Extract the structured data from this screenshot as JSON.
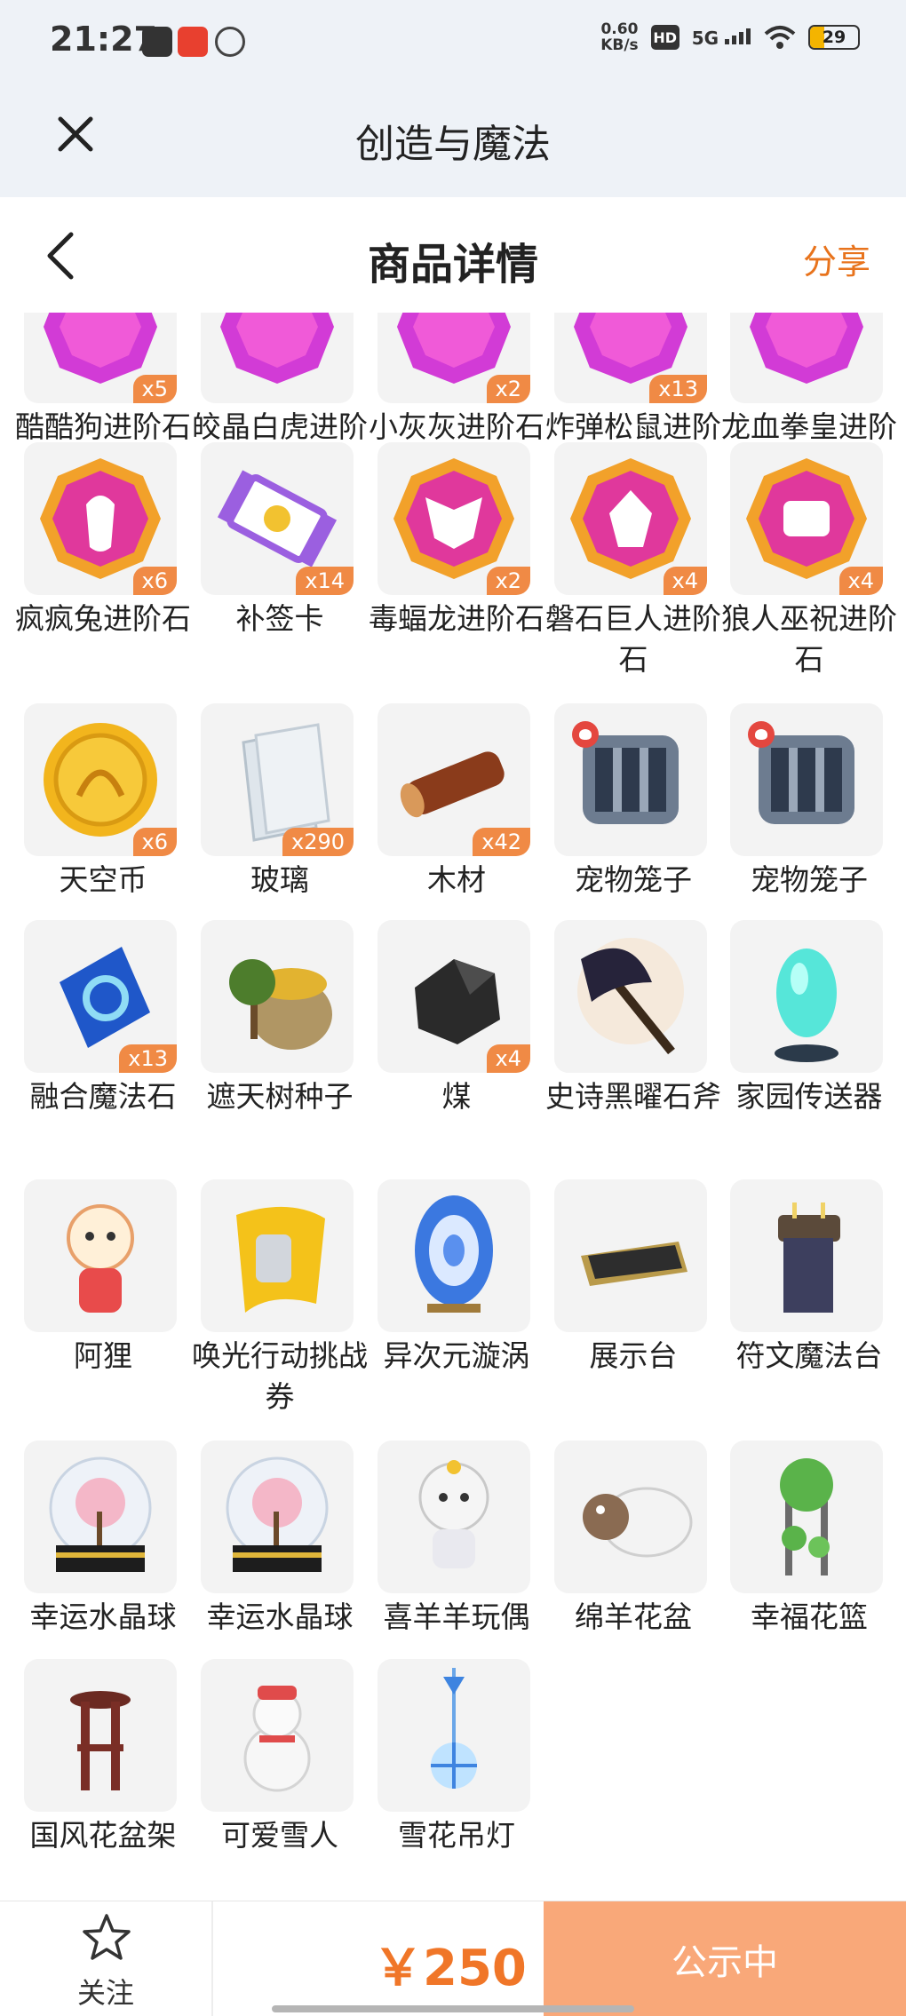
{
  "status_bar": {
    "time": "21:27",
    "net_speed": "0.60",
    "net_unit": "KB/s",
    "hd": "HD",
    "signal": "5G",
    "battery": "29"
  },
  "header": {
    "title": "创造与魔法"
  },
  "detail": {
    "title": "商品详情",
    "share": "分享"
  },
  "colors": {
    "accent": "#f07628",
    "badge": "#f08a45",
    "button": "#f9a879",
    "background": "#eef2f7"
  },
  "items": [
    {
      "name": "酷酷狗进阶石",
      "qty": "x5",
      "icon": "gem-purple-icon"
    },
    {
      "name": "皎晶白虎进阶石",
      "qty": "",
      "icon": "gem-purple-icon"
    },
    {
      "name": "小灰灰进阶石",
      "qty": "x2",
      "icon": "gem-purple-icon"
    },
    {
      "name": "炸弹松鼠进阶石",
      "qty": "x13",
      "icon": "gem-purple-icon"
    },
    {
      "name": "龙血拳皇进阶石",
      "qty": "",
      "icon": "gem-purple-icon"
    },
    {
      "name": "疯疯兔进阶石",
      "qty": "x6",
      "icon": "gem-rabbit-icon"
    },
    {
      "name": "补签卡",
      "qty": "x14",
      "icon": "ticket-icon"
    },
    {
      "name": "毒蝠龙进阶石",
      "qty": "x2",
      "icon": "gem-dragon-icon"
    },
    {
      "name": "磐石巨人进阶石",
      "qty": "x4",
      "icon": "gem-giant-icon"
    },
    {
      "name": "狼人巫祝进阶石",
      "qty": "x4",
      "icon": "gem-wolf-icon"
    },
    {
      "name": "天空币",
      "qty": "x6",
      "icon": "coin-icon"
    },
    {
      "name": "玻璃",
      "qty": "x290",
      "icon": "glass-icon"
    },
    {
      "name": "木材",
      "qty": "x42",
      "icon": "wood-icon"
    },
    {
      "name": "宠物笼子",
      "qty": "",
      "icon": "cage-icon",
      "pet": true
    },
    {
      "name": "宠物笼子",
      "qty": "",
      "icon": "cage-icon",
      "pet": true
    },
    {
      "name": "融合魔法石",
      "qty": "x13",
      "icon": "crystal-icon"
    },
    {
      "name": "遮天树种子",
      "qty": "",
      "icon": "seed-bag-icon"
    },
    {
      "name": "煤",
      "qty": "x4",
      "icon": "coal-icon"
    },
    {
      "name": "史诗黑曜石斧",
      "qty": "",
      "icon": "axe-icon"
    },
    {
      "name": "家园传送器",
      "qty": "",
      "icon": "teleporter-icon"
    },
    {
      "name": "阿狸",
      "qty": "",
      "icon": "ali-icon"
    },
    {
      "name": "唤光行动挑战券",
      "qty": "",
      "icon": "scroll-icon"
    },
    {
      "name": "异次元漩涡",
      "qty": "",
      "icon": "vortex-icon"
    },
    {
      "name": "展示台",
      "qty": "",
      "icon": "display-stand-icon"
    },
    {
      "name": "符文魔法台",
      "qty": "",
      "icon": "rune-table-icon"
    },
    {
      "name": "幸运水晶球",
      "qty": "",
      "icon": "crystal-ball-icon"
    },
    {
      "name": "幸运水晶球",
      "qty": "",
      "icon": "crystal-ball-icon"
    },
    {
      "name": "喜羊羊玩偶",
      "qty": "",
      "icon": "sheep-doll-icon"
    },
    {
      "name": "绵羊花盆",
      "qty": "",
      "icon": "sheep-pot-icon"
    },
    {
      "name": "幸福花篮",
      "qty": "",
      "icon": "flower-basket-icon"
    },
    {
      "name": "国风花盆架",
      "qty": "",
      "icon": "flower-stand-icon"
    },
    {
      "name": "可爱雪人",
      "qty": "",
      "icon": "snowman-icon"
    },
    {
      "name": "雪花吊灯",
      "qty": "",
      "icon": "snowflake-lamp-icon"
    }
  ],
  "bottom": {
    "follow": "关注",
    "price": "￥250",
    "status": "公示中"
  }
}
